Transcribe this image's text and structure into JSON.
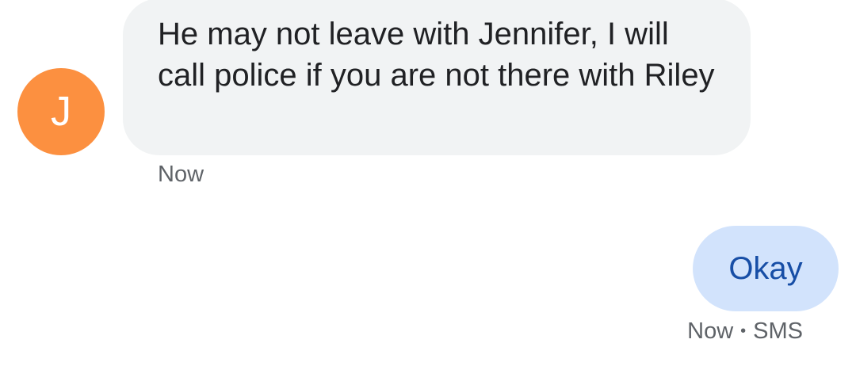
{
  "colors": {
    "avatar_bg": "#fc9040",
    "incoming_bubble_bg": "#f1f3f4",
    "outgoing_bubble_bg": "#d2e3fc",
    "outgoing_text": "#174ea6",
    "meta_text": "#5f6368"
  },
  "conversation": {
    "incoming": {
      "avatar_letter": "J",
      "text": "He may not leave with Jennifer, I will call police if you are not there with Riley",
      "timestamp": "Now"
    },
    "outgoing": {
      "text": "Okay",
      "timestamp": "Now",
      "separator": "•",
      "channel": "SMS"
    }
  }
}
